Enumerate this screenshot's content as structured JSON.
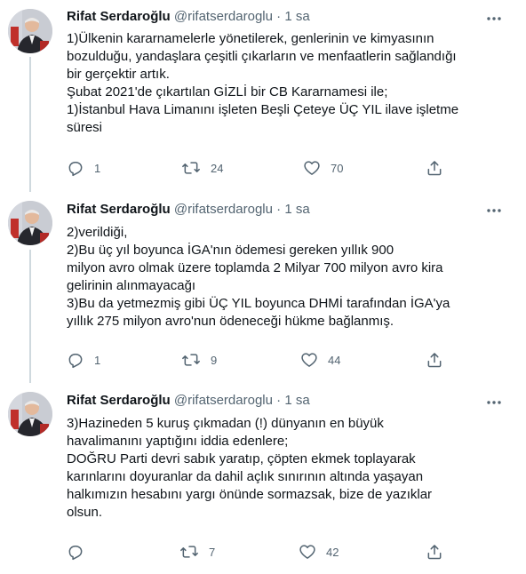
{
  "tweets": [
    {
      "author_name": "Rifat Serdaroğlu",
      "handle": "@rifatserdaroglu",
      "separator": "·",
      "time": "1 sa",
      "lines": [
        "1)Ülkenin kararnamelerle yönetilerek, genlerinin ve kimyasının",
        "bozulduğu, yandaşlara çeşitli çıkarların ve menfaatlerin sağlandığı",
        "bir gerçektir artık.",
        "Şubat 2021'de çıkartılan GİZLİ bir CB Kararnamesi ile;",
        "1)İstanbul Hava Limanını işleten Beşli Çeteye ÜÇ YIL ilave işletme",
        "süresi"
      ],
      "replies": "1",
      "retweets": "24",
      "likes": "70"
    },
    {
      "author_name": "Rifat Serdaroğlu",
      "handle": "@rifatserdaroglu",
      "separator": "·",
      "time": "1 sa",
      "lines": [
        "2)verildiği,",
        "2)Bu üç yıl boyunca İGA'nın ödemesi gereken yıllık 900",
        "milyon avro olmak üzere toplamda 2 Milyar 700 milyon avro kira",
        "gelirinin alınmayacağı",
        "3)Bu da yetmezmiş gibi ÜÇ YIL boyunca DHMİ tarafından İGA'ya",
        "yıllık 275 milyon avro'nun ödeneceği hükme bağlanmış."
      ],
      "replies": "1",
      "retweets": "9",
      "likes": "44"
    },
    {
      "author_name": "Rifat Serdaroğlu",
      "handle": "@rifatserdaroglu",
      "separator": "·",
      "time": "1 sa",
      "lines": [
        "3)Hazineden 5 kuruş çıkmadan (!) dünyanın en büyük",
        "havalimanını yaptığını iddia edenlere;",
        "DOĞRU Parti devri sabık yaratıp, çöpten ekmek toplayarak",
        "karınlarını doyuranlar da dahil açlık sınırının altında yaşayan",
        "halkımızın hesabını yargı önünde sormazsak, bize de yazıklar",
        "olsun."
      ],
      "replies": "",
      "retweets": "7",
      "likes": "42"
    }
  ],
  "icons": {
    "reply": "reply-icon",
    "retweet": "retweet-icon",
    "like": "heart-icon",
    "share": "share-icon",
    "more": "more-icon"
  },
  "colors": {
    "text": "#0f1419",
    "secondary": "#536471",
    "thread_line": "#cfd9de",
    "divider": "#eff3f4"
  }
}
